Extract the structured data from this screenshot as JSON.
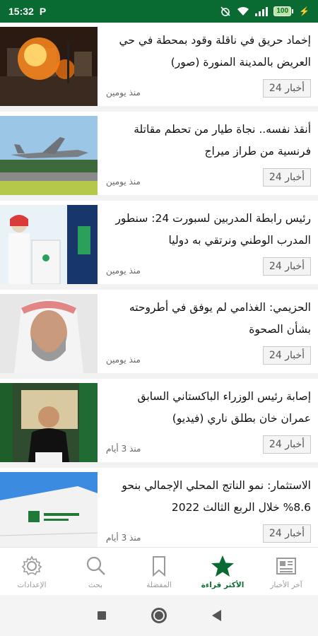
{
  "status_bar": {
    "time": "15:32",
    "p_glyph": "P",
    "battery": "100",
    "bolt": "⚡"
  },
  "feed": {
    "items": [
      {
        "headline": "إخماد حريق في ناقلة وقود بمحطة في حي العريض بالمدينة المنورة (صور)",
        "source": "أخبار 24",
        "time_ago": "منذ يومين",
        "image": "fire-scene-image"
      },
      {
        "headline": "أنقذ نفسه.. نجاة طيار من تحطم مقاتلة فرنسية من طراز ميراج",
        "source": "أخبار 24",
        "time_ago": "منذ يومين",
        "image": "fighter-jet-image"
      },
      {
        "headline": "رئيس رابطة المدربين لسبورت 24: سنطور المدرب الوطني ونرتقي به دوليا",
        "source": "أخبار 24",
        "time_ago": "منذ يومين",
        "image": "conference-podium-image"
      },
      {
        "headline": "الحزيمي: الغذامي لم يوفق في أطروحته بشأن الصحوة",
        "source": "أخبار 24",
        "time_ago": "منذ يومين",
        "image": "portrait-shemagh-image"
      },
      {
        "headline": "إصابة رئيس الوزراء الباكستاني السابق عمران خان بطلق ناري (فيديو)",
        "source": "أخبار 24",
        "time_ago": "منذ 3 أيام",
        "image": "imran-khan-image"
      },
      {
        "headline": "الاستثمار: نمو الناتج المحلي الإجمالي بنحو 8.6% خلال الربع الثالث 2022",
        "source": "أخبار 24",
        "time_ago": "منذ 3 أيام",
        "image": "ministry-building-image"
      }
    ]
  },
  "bottom_nav": {
    "items": [
      {
        "label": "الإعدادات",
        "icon": "gear-icon"
      },
      {
        "label": "بحث",
        "icon": "search-icon"
      },
      {
        "label": "المفضلة",
        "icon": "bookmark-icon"
      },
      {
        "label": "الأكثر قراءة",
        "icon": "star-icon",
        "active": true
      },
      {
        "label": "آخر الأخبار",
        "icon": "newspaper-icon"
      }
    ]
  },
  "colors": {
    "primary": "#0a6b32",
    "nav_inactive": "#9a9a9a"
  }
}
